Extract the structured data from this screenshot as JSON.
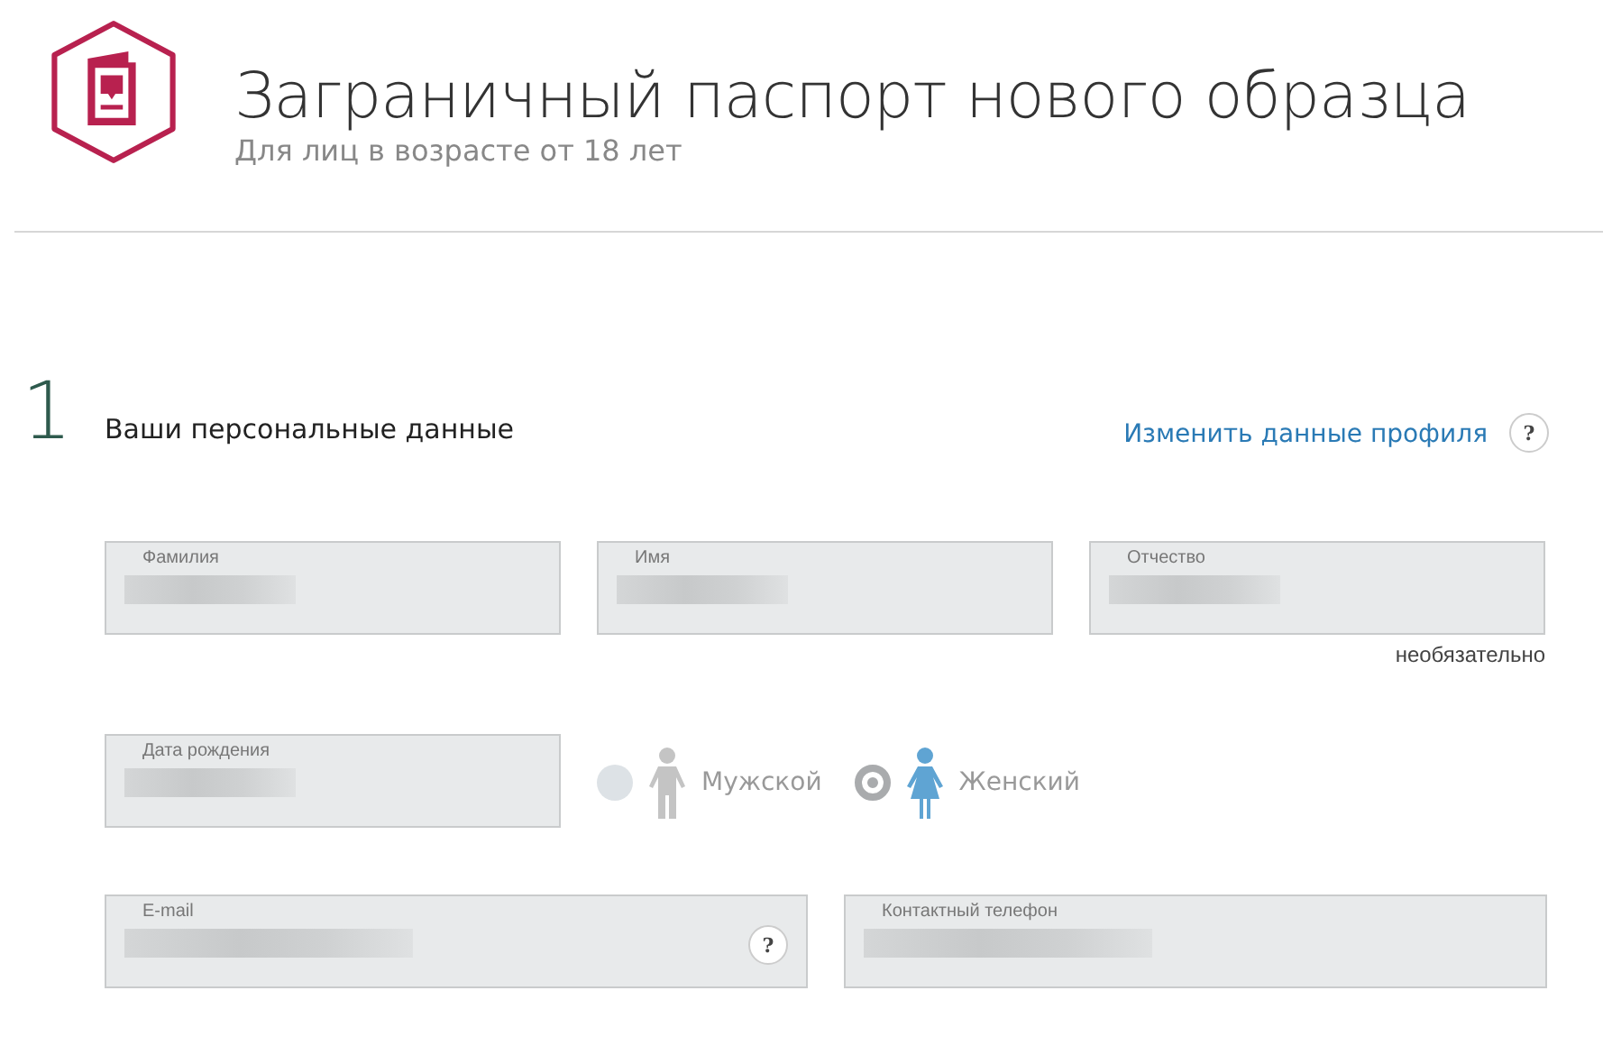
{
  "header": {
    "title": "Заграничный паспорт нового образца",
    "subtitle": "Для лиц в возрасте от 18 лет"
  },
  "section": {
    "number": "1",
    "title": "Ваши персональные данные",
    "link": "Изменить данные профиля",
    "help": "?"
  },
  "name_fields": [
    {
      "label": "Фамилия"
    },
    {
      "label": "Имя"
    },
    {
      "label": "Отчество",
      "note": "необязательно"
    }
  ],
  "birth_field": {
    "label": "Дата рождения"
  },
  "gender": [
    {
      "label": "Мужской",
      "kind": "male",
      "selected": false
    },
    {
      "label": "Женский",
      "kind": "female",
      "selected": true
    }
  ],
  "contact_fields": [
    {
      "label": "E-mail",
      "help": "?"
    },
    {
      "label": "Контактный телефон"
    }
  ]
}
